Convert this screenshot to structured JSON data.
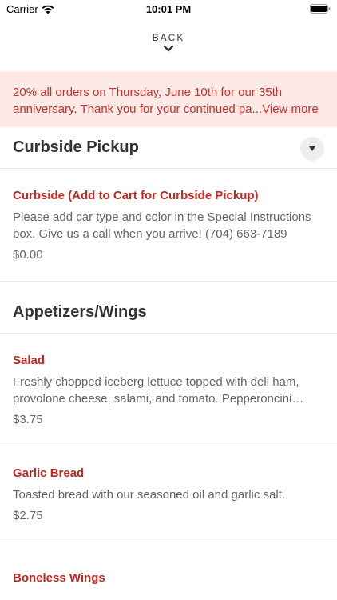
{
  "status_bar": {
    "carrier": "Carrier",
    "time": "10:01 PM"
  },
  "nav": {
    "back_label": "BACK"
  },
  "promo": {
    "text": "20% all orders on Thursday, June 10th for our 35th anniversary. Thank you for your continued pa...",
    "link_label": "View more"
  },
  "sections": {
    "curbside": {
      "title": "Curbside Pickup",
      "items": [
        {
          "name": "Curbside (Add to Cart for Curbside Pickup)",
          "description": "Please add car type and color in the Special Instructions box. Give us a call when you arrive! (704) 663-7189",
          "price": "$0.00"
        }
      ]
    },
    "appetizers": {
      "title": "Appetizers/Wings",
      "items": [
        {
          "name": "Salad",
          "description": "Freshly chopped iceberg lettuce topped with deli ham, provolone cheese, salami, and tomato. Pepperoncini peppers...",
          "price": "$3.75"
        },
        {
          "name": "Garlic Bread",
          "description": "Toasted bread with our seasoned oil and garlic salt.",
          "price": "$2.75"
        },
        {
          "name": "Boneless Wings"
        }
      ]
    }
  },
  "colors": {
    "accent": "#c2271f",
    "promo_bg": "#fdeae6",
    "promo_text": "#c9302c"
  },
  "icons": [
    "wifi-icon",
    "battery-icon",
    "chevron-down-icon",
    "caret-down-icon"
  ]
}
